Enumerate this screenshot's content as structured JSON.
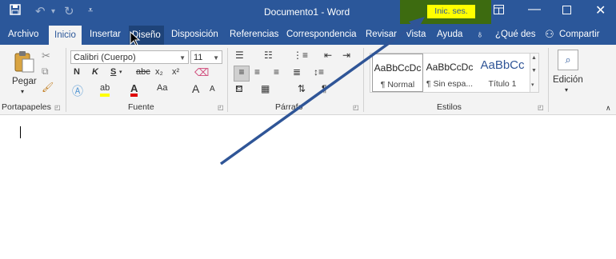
{
  "title_bar": {
    "document_title": "Documento1",
    "separator": " - ",
    "app_name": "Word",
    "sign_in": "Inic. ses."
  },
  "tabs": [
    {
      "label": "Archivo"
    },
    {
      "label": "Inicio"
    },
    {
      "label": "Insertar"
    },
    {
      "label": "Diseño"
    },
    {
      "label": "Disposición"
    },
    {
      "label": "Referencias"
    },
    {
      "label": "Correspondencia"
    },
    {
      "label": "Revisar"
    },
    {
      "label": "Vista"
    },
    {
      "label": "Ayuda"
    }
  ],
  "tell_me": "¿Qué des",
  "share": "Compartir",
  "clipboard": {
    "paste_label": "Pegar",
    "group_label": "Portapapeles"
  },
  "font": {
    "font_name": "Calibri (Cuerpo)",
    "font_size": "11",
    "bold": "N",
    "italic": "K",
    "underline": "S",
    "strikethrough": "abc",
    "subscript": "x₂",
    "superscript": "x²",
    "grow": "A",
    "shrink": "A",
    "case": "Aa",
    "group_label": "Fuente"
  },
  "paragraph": {
    "group_label": "Párrafo"
  },
  "styles": {
    "items": [
      {
        "preview": "AaBbCcDc",
        "name": "¶ Normal"
      },
      {
        "preview": "AaBbCcDc",
        "name": "¶ Sin espa..."
      },
      {
        "preview": "AaBbCc",
        "name": "Título 1"
      }
    ],
    "group_label": "Estilos"
  },
  "editing": {
    "label": "Edición"
  },
  "colors": {
    "ribbon_blue": "#2b579a",
    "sign_in_highlight": "#ffff00",
    "highlight_box": "#3d6b10",
    "arrow": "#2f5597"
  }
}
